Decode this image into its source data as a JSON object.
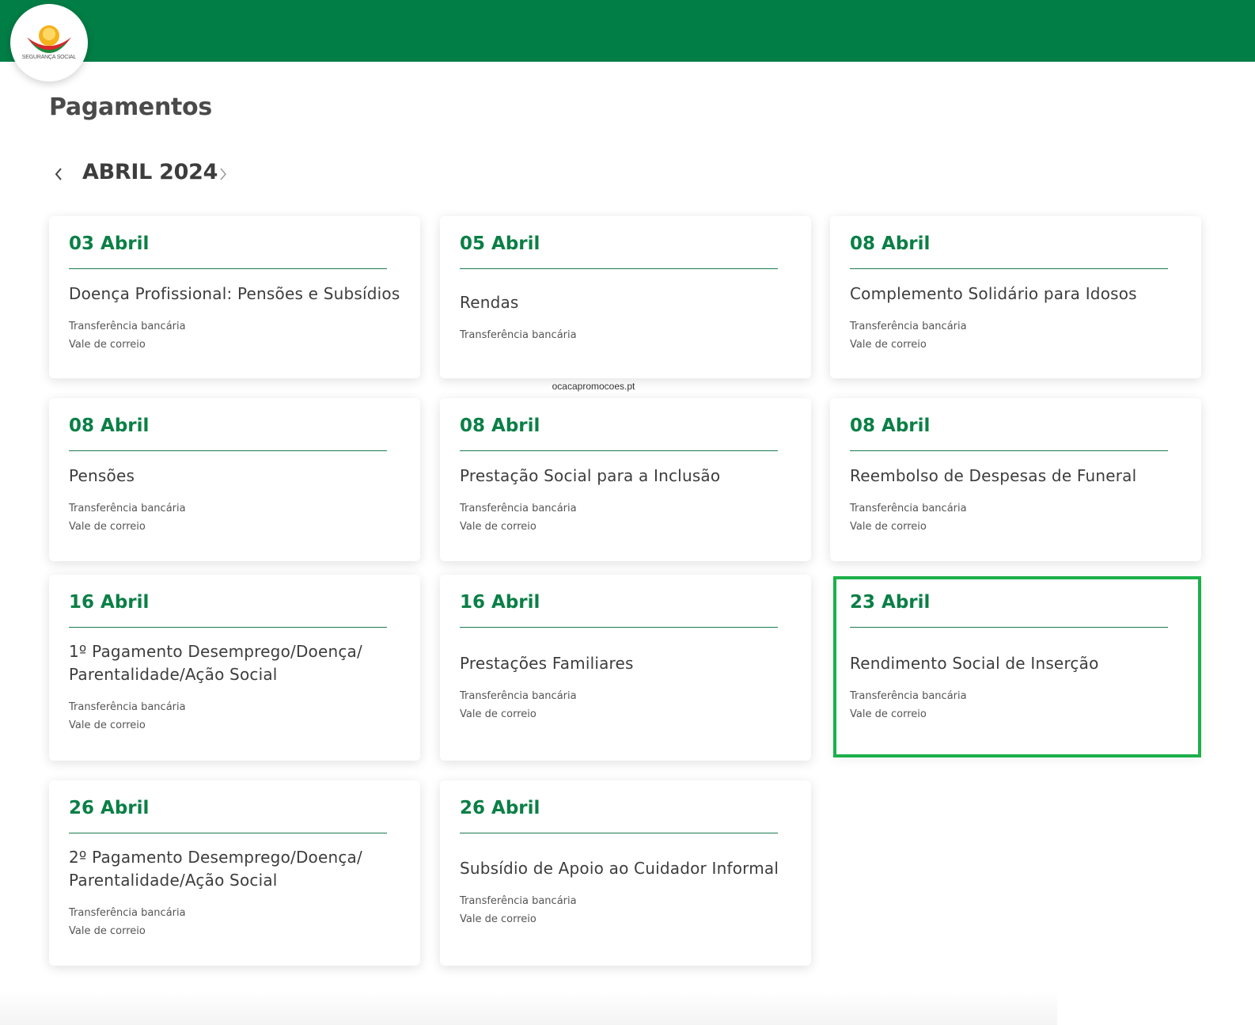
{
  "brand": {
    "logo_text": "SEGURANÇA SOCIAL",
    "header_color": "#007e45",
    "accent_color": "#0a7f46",
    "highlight_color": "#1db04a"
  },
  "page": {
    "title": "Pagamentos"
  },
  "month_nav": {
    "prev_icon": "chevron-left-icon",
    "label": "ABRIL 2024",
    "next_icon": "chevron-right-icon"
  },
  "watermark": "ocacapromocoes.pt",
  "cards": [
    {
      "date": "03 Abril",
      "title": "Doença Profissional: Pensões e Subsídios",
      "methods": [
        "Transferência bancária",
        "Vale de correio"
      ]
    },
    {
      "date": "05 Abril",
      "title": "Rendas",
      "methods": [
        "Transferência bancária"
      ]
    },
    {
      "date": "08 Abril",
      "title": "Complemento Solidário para Idosos",
      "methods": [
        "Transferência bancária",
        "Vale de correio"
      ]
    },
    {
      "date": "08 Abril",
      "title": "Pensões",
      "methods": [
        "Transferência bancária",
        "Vale de correio"
      ]
    },
    {
      "date": "08 Abril",
      "title": "Prestação Social para a Inclusão",
      "methods": [
        "Transferência bancária",
        "Vale de correio"
      ]
    },
    {
      "date": "08 Abril",
      "title": "Reembolso de Despesas de Funeral",
      "methods": [
        "Transferência bancária",
        "Vale de correio"
      ]
    },
    {
      "date": "16 Abril",
      "title": "1º Pagamento Desemprego/Doença/ Parentalidade/Ação Social",
      "methods": [
        "Transferência bancária",
        "Vale de correio"
      ]
    },
    {
      "date": "16 Abril",
      "title": "Prestações Familiares",
      "methods": [
        "Transferência bancária",
        "Vale de correio"
      ]
    },
    {
      "date": "23 Abril",
      "title": "Rendimento Social de Inserção",
      "methods": [
        "Transferência bancária",
        "Vale de correio"
      ],
      "highlighted": true
    },
    {
      "date": "26 Abril",
      "title": "2º Pagamento Desemprego/Doença/ Parentalidade/Ação Social",
      "methods": [
        "Transferência bancária",
        "Vale de correio"
      ]
    },
    {
      "date": "26 Abril",
      "title": "Subsídio de Apoio ao Cuidador Informal",
      "methods": [
        "Transferência bancária",
        "Vale de correio"
      ]
    }
  ]
}
